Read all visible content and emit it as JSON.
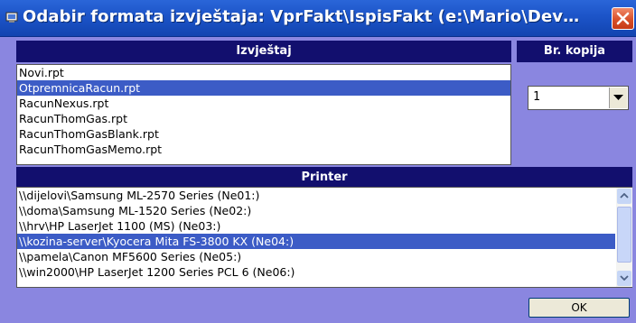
{
  "window": {
    "title": "Odabir formata izvještaja: VprFakt\\IspisFakt (e:\\Mario\\Dev…",
    "icon": "app-icon",
    "close_icon": "close-icon"
  },
  "report": {
    "header": "Izvještaj",
    "items": [
      {
        "label": "Novi.rpt",
        "selected": false
      },
      {
        "label": "OtpremnicaRacun.rpt",
        "selected": true
      },
      {
        "label": "RacunNexus.rpt",
        "selected": false
      },
      {
        "label": "RacunThomGas.rpt",
        "selected": false
      },
      {
        "label": "RacunThomGasBlank.rpt",
        "selected": false
      },
      {
        "label": "RacunThomGasMemo.rpt",
        "selected": false
      }
    ]
  },
  "copies": {
    "header": "Br. kopija",
    "value": "1"
  },
  "printer": {
    "header": "Printer",
    "items": [
      {
        "label": "\\\\dijelovi\\Samsung ML-2570 Series (Ne01:)",
        "selected": false
      },
      {
        "label": "\\\\doma\\Samsung ML-1520 Series (Ne02:)",
        "selected": false
      },
      {
        "label": "\\\\hrv\\HP LaserJet 1100 (MS) (Ne03:)",
        "selected": false
      },
      {
        "label": "\\\\kozina-server\\Kyocera Mita FS-3800 KX (Ne04:)",
        "selected": true
      },
      {
        "label": "\\\\pamela\\Canon MF5600 Series (Ne05:)",
        "selected": false
      },
      {
        "label": "\\\\win2000\\HP LaserJet 1200 Series PCL 6 (Ne06:)",
        "selected": false
      }
    ]
  },
  "ok_label": "OK",
  "colors": {
    "window_bg": "#8a86e0",
    "header_bg": "#120f6e",
    "selection": "#3c5cc6",
    "titlebar": "#1c54c8"
  }
}
